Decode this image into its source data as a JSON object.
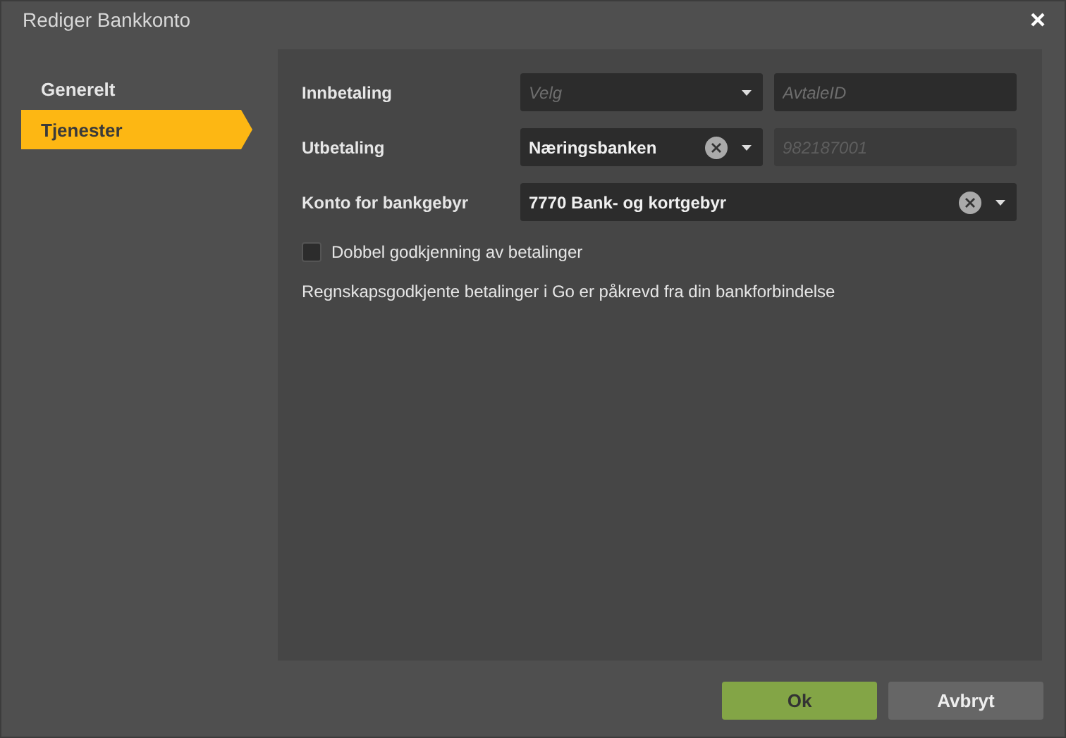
{
  "window": {
    "title": "Rediger Bankkonto"
  },
  "sidebar": {
    "items": [
      {
        "label": "Generelt",
        "selected": false
      },
      {
        "label": "Tjenester",
        "selected": true
      }
    ]
  },
  "form": {
    "rows": [
      {
        "label": "Innbetaling",
        "select": {
          "placeholder": "Velg",
          "clearable": false
        },
        "input": {
          "placeholder": "AvtaleID",
          "disabled": false
        }
      },
      {
        "label": "Utbetaling",
        "select": {
          "value": "Næringsbanken",
          "clearable": true
        },
        "input": {
          "placeholder": "982187001",
          "disabled": true
        }
      },
      {
        "label": "Konto for bankgebyr",
        "select": {
          "value": "7770 Bank- og kortgebyr",
          "clearable": true
        }
      }
    ],
    "checkbox": {
      "label": "Dobbel godkjenning av betalinger",
      "checked": false
    },
    "note": "Regnskapsgodkjente betalinger i Go er påkrevd fra din bankforbindelse"
  },
  "buttons": [
    {
      "label": "Ok",
      "kind": "primary"
    },
    {
      "label": "Avbryt",
      "kind": "secondary"
    }
  ]
}
